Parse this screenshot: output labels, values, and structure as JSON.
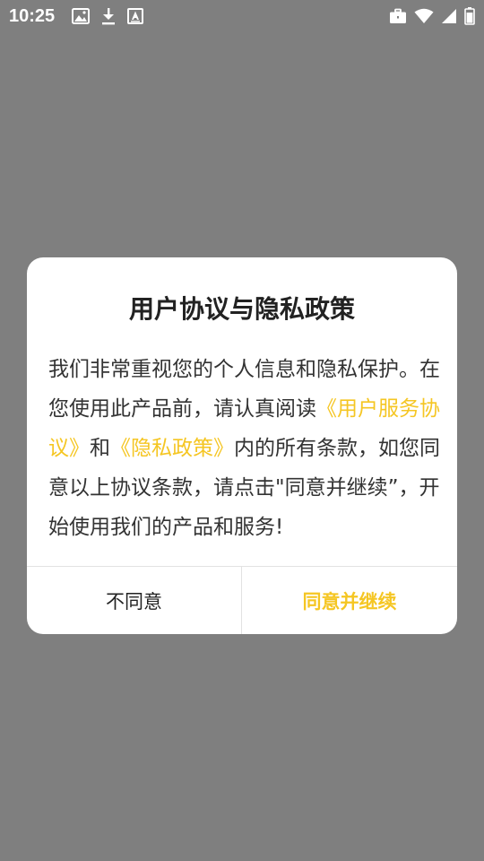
{
  "status_bar": {
    "time": "10:25",
    "icons_left": [
      "image-icon",
      "download-icon",
      "font-icon"
    ],
    "icons_right": [
      "briefcase-icon",
      "wifi-icon",
      "signal-icon",
      "battery-icon"
    ]
  },
  "dialog": {
    "title": "用户协议与隐私政策",
    "body": {
      "text_1": "我们非常重视您的个人信息和隐私保护。在您使用此产品前，请认真阅读",
      "link_user_agreement": "《用户服务协议》",
      "text_2": "和",
      "link_privacy_policy": "《隐私政策》",
      "text_3": "内的所有条款，如您同意以上协议条款，请点击\"同意并继续”，开始使用我们的产品和服务!"
    },
    "buttons": {
      "disagree_label": "不同意",
      "agree_label": "同意并继续"
    }
  },
  "colors": {
    "overlay": "#7f7f7f",
    "accent": "#f5c623",
    "dialog_bg": "#ffffff",
    "text": "#333333"
  }
}
